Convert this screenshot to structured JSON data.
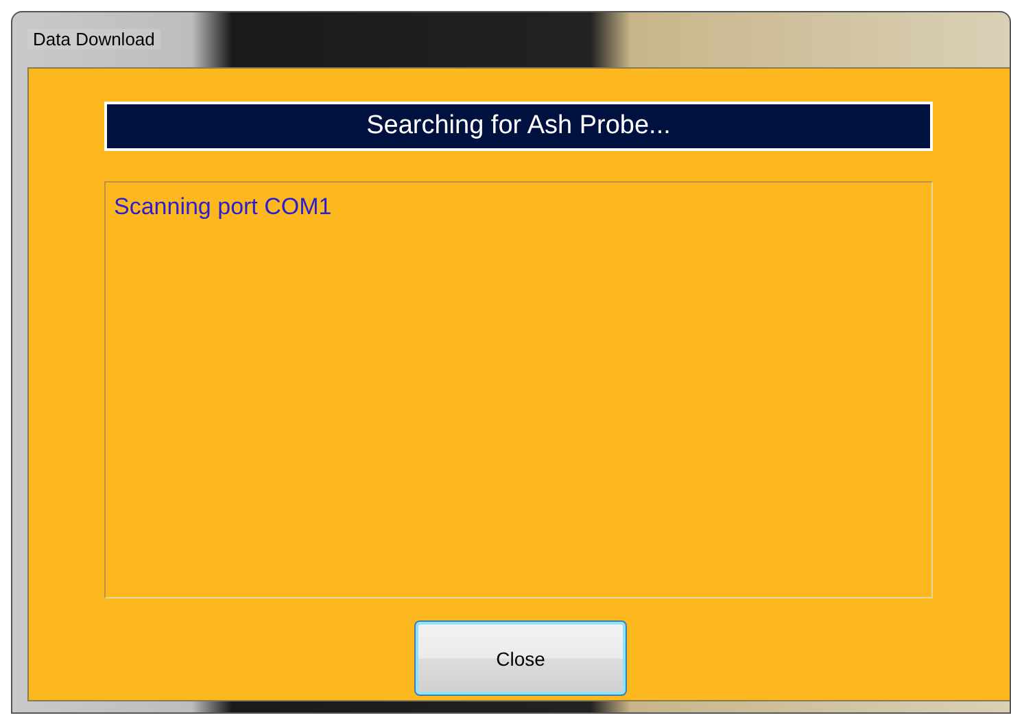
{
  "window": {
    "title": "Data Download"
  },
  "header": {
    "text": "Searching for Ash Probe..."
  },
  "log": {
    "lines": [
      "Scanning port COM1"
    ]
  },
  "buttons": [
    {
      "label": "Close",
      "focused": true
    }
  ]
}
